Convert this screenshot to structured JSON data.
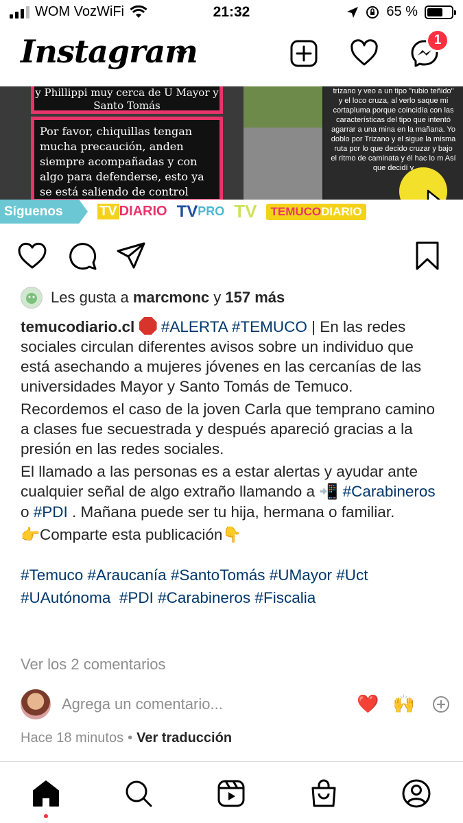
{
  "status_bar": {
    "carrier": "WOM VozWiFi",
    "time": "21:32",
    "battery_percent": "65 %",
    "battery_level": 0.65
  },
  "header": {
    "logo": "Instagram",
    "messages_badge": "1",
    "icons": [
      "chevron-down-icon",
      "new-post-icon",
      "heart-icon",
      "messenger-icon"
    ]
  },
  "post_image": {
    "card_top_text": "y Phillippi muy cerca de U Mayor y Santo Tomás",
    "card_main_text": "Por favor, chiquillas tengan mucha precaución, anden siempre acompañadas y con algo para defenderse, esto ya se está saliendo de control ❗❗❗😟",
    "right_panel_text": "trizano y veo a un tipo \"rubio teñido\" y el loco cruza, al verlo saque mi cortapluma porque coincidía con las características del tipo que intentó agarrar a una mina en la mañana. Yo doblo por Trizano y el sigue la misma ruta por lo que decido cruzar y bajo el ritmo de caminata y él hac lo m Así que decidí v",
    "siguenos": "Síguenos",
    "brands": {
      "tvdiario_tv": "TV",
      "tvdiario_diario": "DIARIO",
      "tvpro_tv": "TV",
      "tvpro_pro": "PRO",
      "tvplay": "TV",
      "temuco": "TEMUCO",
      "temuco_diario": "DIARIO"
    }
  },
  "likes": {
    "prefix": "Les gusta a ",
    "user": "marcmonc",
    "connector": " y ",
    "count": "157 más"
  },
  "caption": {
    "user": "temucodiario.cl",
    "p1_tag1": "#ALERTA",
    "p1_tag2": "#TEMUCO",
    "p1_text": " | En las redes sociales circulan diferentes avisos sobre un individuo que está asechando a mujeres jóvenes en las cercanías de las universidades Mayor y Santo Tomás de Temuco.",
    "p2": "Recordemos el caso de la joven Carla que temprano camino a clases fue secuestrada y después apareció gracias a la presión en las redes sociales.",
    "p3_text": "El llamado a las personas es a estar alertas y ayudar ante cualquier señal de algo extraño llamando a ",
    "p3_emoji": "📲",
    "p3_tag1": "#Carabineros",
    "p3_mid": " o ",
    "p3_tag2": "#PDI",
    "p3_end": " . Mañana puede ser tu hija, hermana o familiar.",
    "p4_emoji1": "👉",
    "p4_text": "Comparte esta publicación",
    "p4_emoji2": "👇",
    "hashtags_line1": "#Temuco #Araucanía #SantoTomás #UMayor #Uct",
    "hashtags_line2": "#UAutónoma  #PDI #Carabineros #Fiscalia"
  },
  "view_comments": "Ver los 2 comentarios",
  "comment_input": {
    "placeholder": "Agrega un comentario...",
    "quick_heart": "❤️",
    "quick_hands": "🙌"
  },
  "meta": {
    "time_ago": "Hace 18 minutos",
    "separator": "•",
    "translate": "Ver traducción"
  },
  "bottom_nav": [
    "home-icon",
    "search-icon",
    "reels-icon",
    "shop-icon",
    "profile-icon"
  ],
  "colors": {
    "accent_red": "#ff3040",
    "hashtag_blue": "#00376b",
    "muted": "#8e8e8e"
  }
}
